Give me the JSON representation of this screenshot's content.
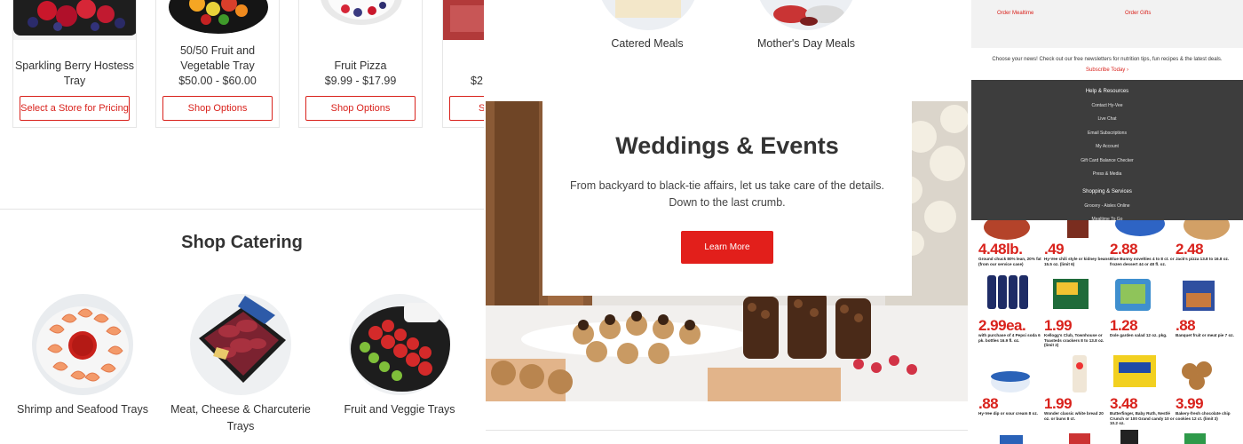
{
  "products": [
    {
      "name": "Sparkling Berry Hostess Tray",
      "price": "",
      "button": "Select a Store for Pricing"
    },
    {
      "name": "50/50 Fruit and Vegetable Tray",
      "price": "$50.00 - $60.00",
      "button": "Shop Options"
    },
    {
      "name": "Fruit Pizza",
      "price": "$9.99 - $17.99",
      "button": "Shop Options"
    },
    {
      "name": "",
      "price": "$2…",
      "button": "S…"
    }
  ],
  "shop_catering": {
    "title": "Shop Catering",
    "categories": [
      {
        "label": "Shrimp and Seafood Trays"
      },
      {
        "label": "Meat, Cheese & Charcuterie Trays"
      },
      {
        "label": "Fruit and Veggie Trays"
      }
    ]
  },
  "meals": {
    "catered": "Catered Meals",
    "mothers_day": "Mother's Day Meals"
  },
  "hero": {
    "title": "Weddings & Events",
    "text_line1": "From backyard to black-tie affairs, let us take care of the details.",
    "text_line2": "Down to the last crumb.",
    "button": "Learn More"
  },
  "right": {
    "links": [
      "Order Mealtime",
      "Order Gifts"
    ],
    "newsletter": "Choose your news! Check out our free newsletters for nutrition tips, fun recipes & the latest deals.",
    "subscribe": "Subscribe Today",
    "footer": {
      "help_heading": "Help & Resources",
      "help_items": [
        "Contact Hy-Vee",
        "Live Chat",
        "Email Subscriptions",
        "My Account",
        "Gift Card Balance Checker",
        "Press & Media"
      ],
      "shop_heading": "Shopping & Services",
      "shop_items": [
        "Grocery - Aisles Online",
        "Mealtime To Go"
      ]
    },
    "flyer": [
      {
        "price": "4.48lb.",
        "desc": "Ground chuck 80% lean, 20% fat (from our service case)"
      },
      {
        "price": ".49",
        "desc": "Hy-Vee chili style or kidney beans 15.5 oz. (limit 6)"
      },
      {
        "price": "2.88",
        "desc": "Blue Bunny novelties 4 to 8 ct. or frozen dessert 44 or 48 fl. oz."
      },
      {
        "price": "2.48",
        "desc": "Jack's pizza 13.8 to 16.8 oz."
      },
      {
        "price": "2.99ea.",
        "desc": "with purchase of 4 Pepsi soda 6 pk. bottles 16.9 fl. oz."
      },
      {
        "price": "1.99",
        "desc": "Kellogg's Club, Townhouse or Toasteds crackers 8 to 13.8 oz. (limit 2)"
      },
      {
        "price": "1.28",
        "desc": "Dole garden salad 12 oz. pkg."
      },
      {
        "price": ".88",
        "desc": "Banquet fruit or meat pie 7 oz."
      },
      {
        "price": ".88",
        "desc": "Hy-Vee dip or sour cream 8 oz."
      },
      {
        "price": "1.99",
        "desc": "Wonder classic white bread 20 oz. or buns 8 ct."
      },
      {
        "price": "3.48",
        "desc": "Butterfinger, Baby Ruth, Nestlé Crunch or 100 Grand candy 10 or 10.2 oz."
      },
      {
        "price": "3.99",
        "desc": "Bakery-fresh chocolate chip cookies 12 ct. (limit 3)"
      }
    ]
  },
  "colors": {
    "brand_red": "#e21f1b",
    "footer_bg": "#3d3d3d",
    "text": "#333333"
  }
}
